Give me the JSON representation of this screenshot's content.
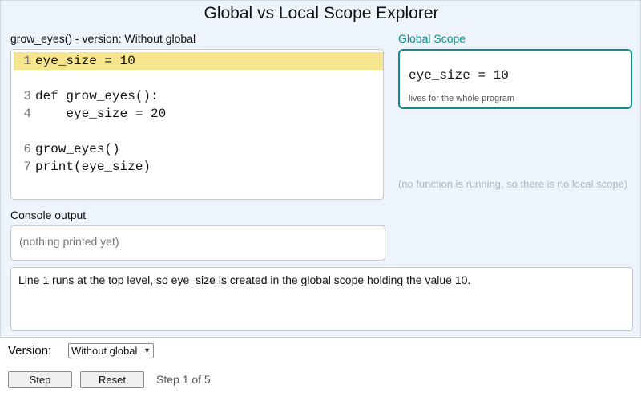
{
  "app": {
    "title": "Global vs Local Scope Explorer"
  },
  "code": {
    "label": "grow_eyes() - version: Without global",
    "lines": [
      {
        "num": "1",
        "text": "eye_size = 10",
        "highlighted": true
      },
      {
        "num": "3",
        "text": "def grow_eyes():"
      },
      {
        "num": "4",
        "text": "    eye_size = 20"
      },
      {
        "num": "6",
        "text": "grow_eyes()"
      },
      {
        "num": "7",
        "text": "print(eye_size)"
      }
    ]
  },
  "global_scope": {
    "label": "Global Scope",
    "variable": "eye_size = 10",
    "note": "lives for the whole program",
    "accent_color": "#138c8c"
  },
  "local_scope": {
    "note": "(no function is running, so there is no local scope)"
  },
  "console": {
    "label": "Console output",
    "text": "(nothing printed yet)"
  },
  "explanation": {
    "text": "Line 1 runs at the top level, so eye_size is created in the global scope holding the value 10."
  },
  "controls": {
    "version_label": "Version:",
    "version_selected": "Without global",
    "step_label": "Step",
    "reset_label": "Reset",
    "step_status": "Step 1 of 5"
  },
  "colors": {
    "highlight": "#f6e58d",
    "panel_bg": "#eef4fb"
  }
}
